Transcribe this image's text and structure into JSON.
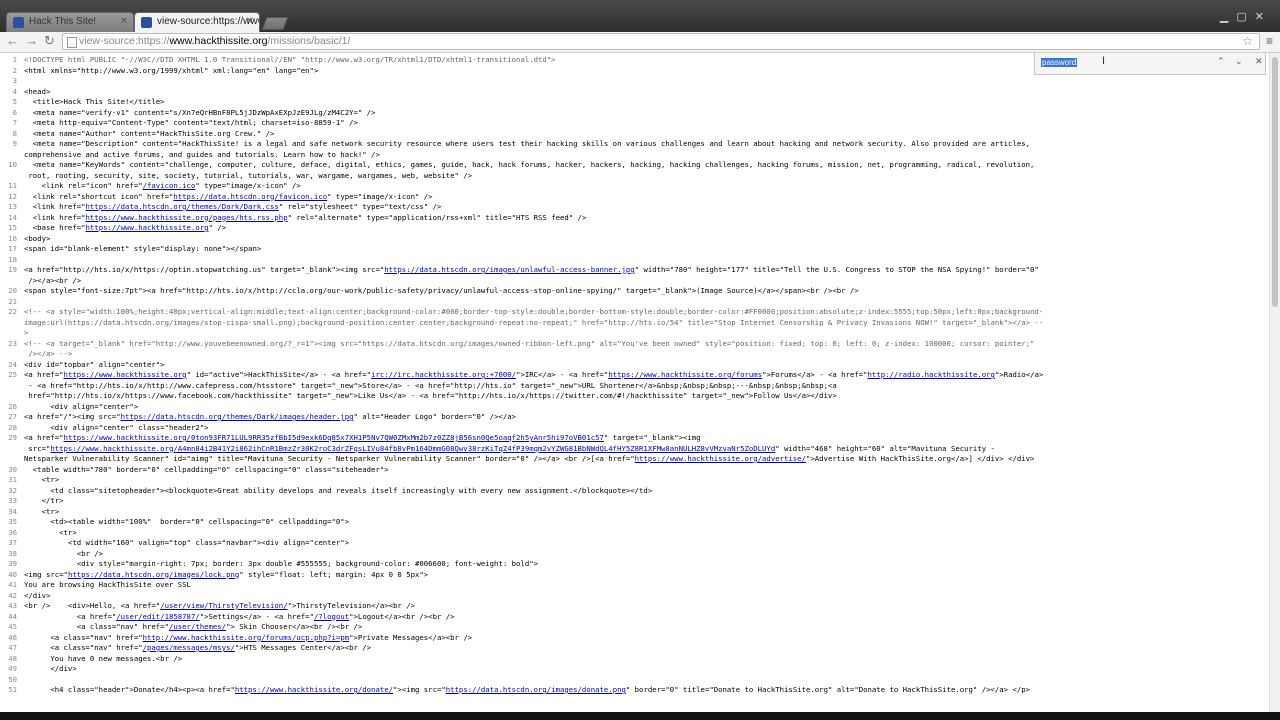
{
  "browser": {
    "tabs": [
      {
        "label": "Hack This Site!",
        "active": false
      },
      {
        "label": "view-source:https://www.",
        "active": true
      }
    ],
    "url_scheme": "view-source:https://",
    "url_host": "www.hackthissite.org",
    "url_path": "/missions/basic/1/"
  },
  "find_bar": {
    "query": "password"
  },
  "source_lines": [
    {
      "n": "1",
      "html": "<span class=\"c\">&lt;!DOCTYPE html PUBLIC \"-//W3C//DTD XHTML 1.0 Transitional//EN\" \"http://www.w3.org/TR/xhtml1/DTD/xhtml1-transitional.dtd\"&gt;</span>"
    },
    {
      "n": "2",
      "html": "&lt;html xmlns=\"http://www.w3.org/1999/xhtml\" xml:lang=\"en\" lang=\"en\"&gt;"
    },
    {
      "n": "3",
      "html": ""
    },
    {
      "n": "4",
      "html": "&lt;head&gt;"
    },
    {
      "n": "5",
      "html": "  &lt;title&gt;Hack This Site!&lt;/title&gt;"
    },
    {
      "n": "6",
      "html": "  &lt;meta name=\"verify-v1\" content=\"s/Xn7eQrHBnF8PL5jJDzWpAxEXpJzE9JLg/zM4C2Y=\" /&gt;"
    },
    {
      "n": "7",
      "html": "  &lt;meta http-equiv=\"Content-Type\" content=\"text/html; charset=iso-8859-1\" /&gt;"
    },
    {
      "n": "8",
      "html": "  &lt;meta name=\"Author\" content=\"HackThisSite.org Crew.\" /&gt;"
    },
    {
      "n": "9",
      "html": "  &lt;meta name=\"Description\" content=\"HackThisSite! is a legal and safe network security resource where users test their hacking skills on various challenges and learn about hacking and network security. Also provided are articles,"
    },
    {
      "n": "",
      "html": "comprehensive and active forums, and guides and tutorials. Learn how to hack!\" /&gt;"
    },
    {
      "n": "10",
      "html": "  &lt;meta name=\"KeyWords\" content=\"challenge, computer, culture, deface, digital, ethics, games, guide, hack, hack forums, hacker, hackers, hacking, hacking challenges, hacking forums, mission, net, programming, radical, revolution,"
    },
    {
      "n": "",
      "html": " root, rooting, security, site, society, tutorial, tutorials, war, wargame, wargames, web, website\" /&gt;"
    },
    {
      "n": "11",
      "html": "    &lt;link rel=\"icon\" href=\"<span class=\"u\">/favicon.ico</span>\" type=\"image/x-icon\" /&gt;"
    },
    {
      "n": "12",
      "html": "  &lt;link rel=\"shortcut icon\" href=\"<span class=\"u\">https://data.htscdn.org/favicon.ico</span>\" type=\"image/x-icon\" /&gt;"
    },
    {
      "n": "13",
      "html": "  &lt;link href=\"<span class=\"u\">https://data.htscdn.org/themes/Dark/Dark.css</span>\" rel=\"stylesheet\" type=\"text/css\" /&gt;"
    },
    {
      "n": "14",
      "html": "  &lt;link href=\"<span class=\"u\">https://www.hackthissite.org/pages/hts.rss.php</span>\" rel=\"alternate\" type=\"application/rss+xml\" title=\"HTS RSS feed\" /&gt;"
    },
    {
      "n": "15",
      "html": "  &lt;base href=\"<span class=\"u\">https://www.hackthissite.org</span>\" /&gt;"
    },
    {
      "n": "16",
      "html": "&lt;body&gt;"
    },
    {
      "n": "17",
      "html": "&lt;span id=\"blank-element\" style=\"display: none\"&gt;&lt;/span&gt;"
    },
    {
      "n": "18",
      "html": ""
    },
    {
      "n": "19",
      "html": "&lt;a href=\"http://hts.io/x/https://optin.stopwatching.us\" target=\"_blank\"&gt;&lt;img src=\"<span class=\"u\">https://data.htscdn.org/images/unlawful-access-banner.jpg</span>\" width=\"780\" height=\"177\" title=\"Tell the U.S. Congress to STOP the NSA Spying!\" border=\"0\""
    },
    {
      "n": "",
      "html": " /&gt;&lt;/a&gt;&lt;br /&gt;"
    },
    {
      "n": "20",
      "html": "&lt;span style=\"font-size:7pt\"&gt;&lt;a href=\"http://hts.io/x/http://ccla.org/our-work/public-safety/privacy/unlawful-access-stop-online-spying/\" target=\"_blank\"&gt;(Image Source)&lt;/a&gt;&lt;/span&gt;&lt;br /&gt;&lt;br /&gt;"
    },
    {
      "n": "21",
      "html": ""
    },
    {
      "n": "22",
      "html": "<span class=\"c\">&lt;!-- &lt;a style=\"width:100%;height:40px;vertical-align:middle;text-align:center;background-color:#000;border-top-style:double;border-bottom-style:double;border-color:#FF0000;position:absolute;z-index:5555;top:50px;left:0px;background-</span>"
    },
    {
      "n": "",
      "html": "<span class=\"c\">image:url(https://data.htscdn.org/images/stop-cispa-small.png);background-position:center center;background-repeat:no-repeat;\" href=\"http://hts.io/54\" title=\"Stop Internet Censorship &amp; Privacy Invasions NOW!\" target=\"_blank\"&gt;&lt;/a&gt; --</span>"
    },
    {
      "n": "",
      "html": "<span class=\"c\">&gt;</span>"
    },
    {
      "n": "23",
      "html": "<span class=\"c\">&lt;!-- &lt;a target=\"_blank\" href=\"http://www.youvebeenowned.org/?_r=1\"&gt;&lt;img src=\"https://data.htscdn.org/images/owned-ribbon-left.png\" alt=\"You've been owned\" style=\"position: fixed; top: 0; left: 0; z-index: 100000; cursor: pointer;\"</span>"
    },
    {
      "n": "",
      "html": "<span class=\"c\"> /&gt;&lt;/a&gt; --&gt;</span>"
    },
    {
      "n": "24",
      "html": "&lt;div id=\"topbar\" align=\"center\"&gt;"
    },
    {
      "n": "25",
      "html": "&lt;a href=\"<span class=\"u\">https://www.hackthissite.org</span>\" id=\"active\"&gt;HackThisSite&lt;/a&gt; - &lt;a href=\"<span class=\"u\">irc://irc.hackthissite.org:+7000/</span>\"&gt;IRC&lt;/a&gt; - &lt;a href=\"<span class=\"u\">https://www.hackthissite.org/forums</span>\"&gt;Forums&lt;/a&gt; - &lt;a href=\"<span class=\"u\">http://radio.hackthissite.org</span>\"&gt;Radio&lt;/a&gt;"
    },
    {
      "n": "",
      "html": " - &lt;a href=\"http://hts.io/x/http://www.cafepress.com/htsstore\" target=\"_new\"&gt;Store&lt;/a&gt; - &lt;a href=\"http://hts.io\" target=\"_new\"&gt;URL Shortener&lt;/a&gt;&amp;nbsp;&amp;nbsp;&amp;nbsp;---&amp;nbsp;&amp;nbsp;&amp;nbsp;&lt;a"
    },
    {
      "n": "",
      "html": " href=\"http://hts.io/x/https://www.facebook.com/hackthissite\" target=\"_new\"&gt;Like Us&lt;/a&gt; - &lt;a href=\"http://hts.io/x/https://twitter.com/#!/hackthissite\" target=\"_new\"&gt;Follow Us&lt;/a&gt;&lt;/div&gt;"
    },
    {
      "n": "26",
      "html": "      &lt;div align=\"center\"&gt;"
    },
    {
      "n": "27",
      "html": "&lt;a href=\"/\"&gt;&lt;img src=\"<span class=\"u\">https://data.htscdn.org/themes/Dark/images/header.jpg</span>\" alt=\"Header Logo\" border=\"0\" /&gt;&lt;/a&gt;"
    },
    {
      "n": "28",
      "html": "      &lt;div align=\"center\" class=\"header2\"&gt;"
    },
    {
      "n": "29",
      "html": "&lt;a href=\"<span class=\"u\">https://www.hackthissite.org/0ton93FR71LUL9RR35zfBbI5d9exk6Dq85x7XH1P5Nv7QW0ZMxMm2b7z0ZZ8jB56sn0Qe5oaqf2h5yAnr5hi97oVB01c57</span>\" target=\"_blank\"&gt;&lt;img"
    },
    {
      "n": "",
      "html": " src=\"<span class=\"u\">https://www.hackthissite.org/A4mn84i2B41Y2i862ihCnR1BmzZr30K2roC3drZFqsLIVu84fb8vPm164DmmG08Qwv38rzKiTqZ4fP39mqm2vYZWG81BbNWdQL4fHY5Z8R1XFMw8anNULHZ8vVMzvaNr5ZoDLUYd</span>\" width=\"468\" height=\"60\" alt=\"Mavituna Security -"
    },
    {
      "n": "",
      "html": "Netsparker Vulnerability Scanner\" id=\"aimg\" title=\"Mavituna Security - Netsparker Vulnerability Scanner\" border=\"0\" /&gt;&lt;/a&gt; &lt;br /&gt;[&lt;a href=\"<span class=\"u\">https://www.hackthissite.org/advertise/</span>\"&gt;Advertise With HackThisSite.org&lt;/a&gt;] &lt;/div&gt; &lt;/div&gt;"
    },
    {
      "n": "30",
      "html": "  &lt;table width=\"780\" border=\"0\" cellpadding=\"0\" cellspacing=\"0\" class=\"siteheader\"&gt;"
    },
    {
      "n": "31",
      "html": "    &lt;tr&gt;"
    },
    {
      "n": "32",
      "html": "      &lt;td class=\"sitetopheader\"&gt;&lt;blockquote&gt;Great ability develops and reveals itself increasingly with every new assignment.&lt;/blockquote&gt;&lt;/td&gt;"
    },
    {
      "n": "33",
      "html": "    &lt;/tr&gt;"
    },
    {
      "n": "34",
      "html": "    &lt;tr&gt;"
    },
    {
      "n": "35",
      "html": "      &lt;td&gt;&lt;table width=\"100%\"  border=\"0\" cellspacing=\"0\" cellpadding=\"0\"&gt;"
    },
    {
      "n": "36",
      "html": "        &lt;tr&gt;"
    },
    {
      "n": "37",
      "html": "          &lt;td width=\"160\" valign=\"top\" class=\"navbar\"&gt;&lt;div align=\"center\"&gt;"
    },
    {
      "n": "38",
      "html": "            &lt;br /&gt;"
    },
    {
      "n": "39",
      "html": "            &lt;div style=\"margin-right: 7px; border: 3px double #555555; background-color: #006600; font-weight: bold\"&gt;"
    },
    {
      "n": "40",
      "html": "&lt;img src=\"<span class=\"u\">https://data.htscdn.org/images/lock.png</span>\" style=\"float: left; margin: 4px 0 0 5px\"&gt;"
    },
    {
      "n": "41",
      "html": "You are browsing HackThisSite over SSL"
    },
    {
      "n": "42",
      "html": "&lt;/div&gt;"
    },
    {
      "n": "43",
      "html": "&lt;br /&gt;    &lt;div&gt;Hello, &lt;a href=\"<span class=\"u\">/user/view/ThirstyTelevision/</span>\"&gt;ThirstyTelevision&lt;/a&gt;&lt;br /&gt;"
    },
    {
      "n": "44",
      "html": "            &lt;a href=\"<span class=\"u\">/user/edit/1858787/</span>\"&gt;Settings&lt;/a&gt; - &lt;a href=\"<span class=\"u\">/?logout</span>\"&gt;Logout&lt;/a&gt;&lt;br /&gt;&lt;br /&gt;"
    },
    {
      "n": "45",
      "html": "            &lt;a class=\"nav\" href=\"<span class=\"u\">/user/themes/</span>\"&gt; Skin Chooser&lt;/a&gt;&lt;br /&gt;&lt;br /&gt;"
    },
    {
      "n": "46",
      "html": "      &lt;a class=\"nav\" href=\"<span class=\"u\">http://www.hackthissite.org/forums/ucp.php?i=pm</span>\"&gt;Private Messages&lt;/a&gt;&lt;br /&gt;"
    },
    {
      "n": "47",
      "html": "      &lt;a class=\"nav\" href=\"<span class=\"u\">/pages/messages/msys/</span>\"&gt;HTS Messages Center&lt;/a&gt;&lt;br /&gt;"
    },
    {
      "n": "48",
      "html": "      You have 0 new messages.&lt;br /&gt;"
    },
    {
      "n": "49",
      "html": "      &lt;/div&gt;"
    },
    {
      "n": "50",
      "html": ""
    },
    {
      "n": "51",
      "html": "      &lt;h4 class=\"header\"&gt;Donate&lt;/h4&gt;&lt;p&gt;&lt;a href=\"<span class=\"u\">https://www.hackthissite.org/donate/</span>\"&gt;&lt;img src=\"<span class=\"u\">https://data.htscdn.org/images/donate.png</span>\" border=\"0\" title=\"Donate to HackThisSite.org\" alt=\"Donate to HackThisSite.org\" /&gt;&lt;/a&gt; &lt;/p&gt;"
    }
  ]
}
